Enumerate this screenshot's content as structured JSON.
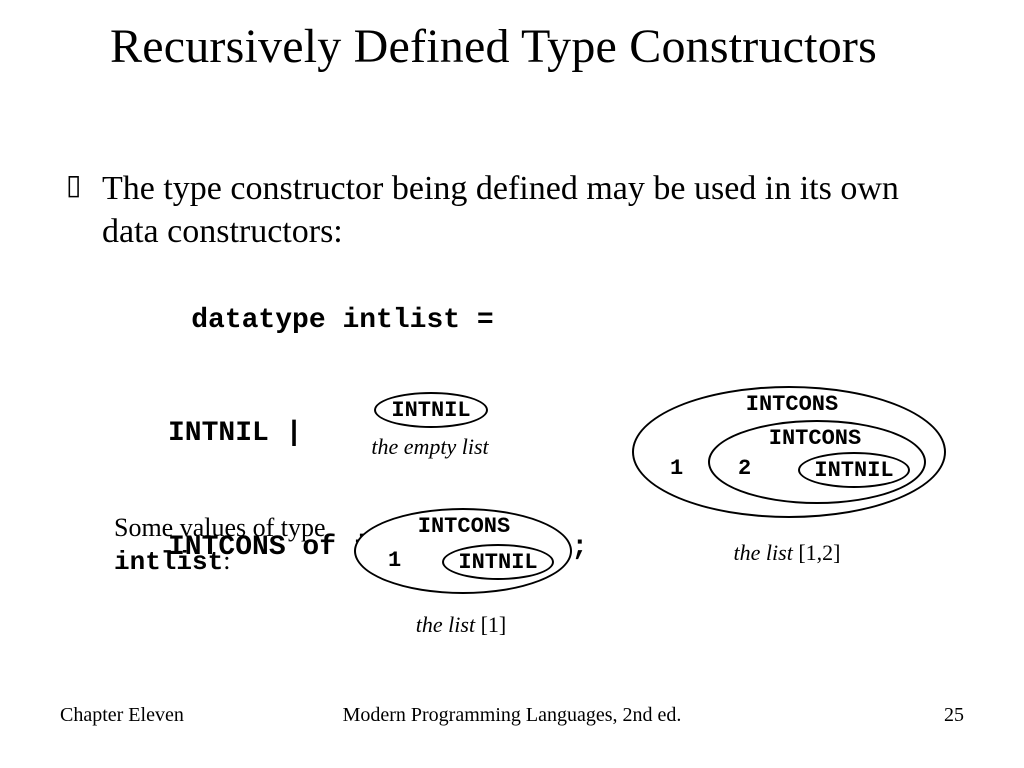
{
  "title": "Recursively Defined Type Constructors",
  "bullet": "The type constructor being defined may be used in its own data constructors:",
  "code": {
    "line1": "datatype intlist =",
    "line2": "INTNIL |",
    "line3": "INTCONS of int * intlist;"
  },
  "side_note": {
    "prefix": "Some values of type ",
    "typename": "intlist",
    "suffix": ":"
  },
  "examples": {
    "intnil": {
      "label": "INTNIL",
      "caption": "the empty list"
    },
    "cons1": {
      "outer_label": "INTCONS",
      "value1": "1",
      "inner_label": "INTNIL",
      "caption_prefix": "the list ",
      "caption_value": "[1]"
    },
    "cons12": {
      "outer_label": "INTCONS",
      "mid_label": "INTCONS",
      "value1": "1",
      "value2": "2",
      "inner_label": "INTNIL",
      "caption_prefix": "the list ",
      "caption_value": "[1,2]"
    }
  },
  "footer": {
    "left": "Chapter Eleven",
    "center": "Modern Programming Languages, 2nd ed.",
    "right": "25"
  }
}
